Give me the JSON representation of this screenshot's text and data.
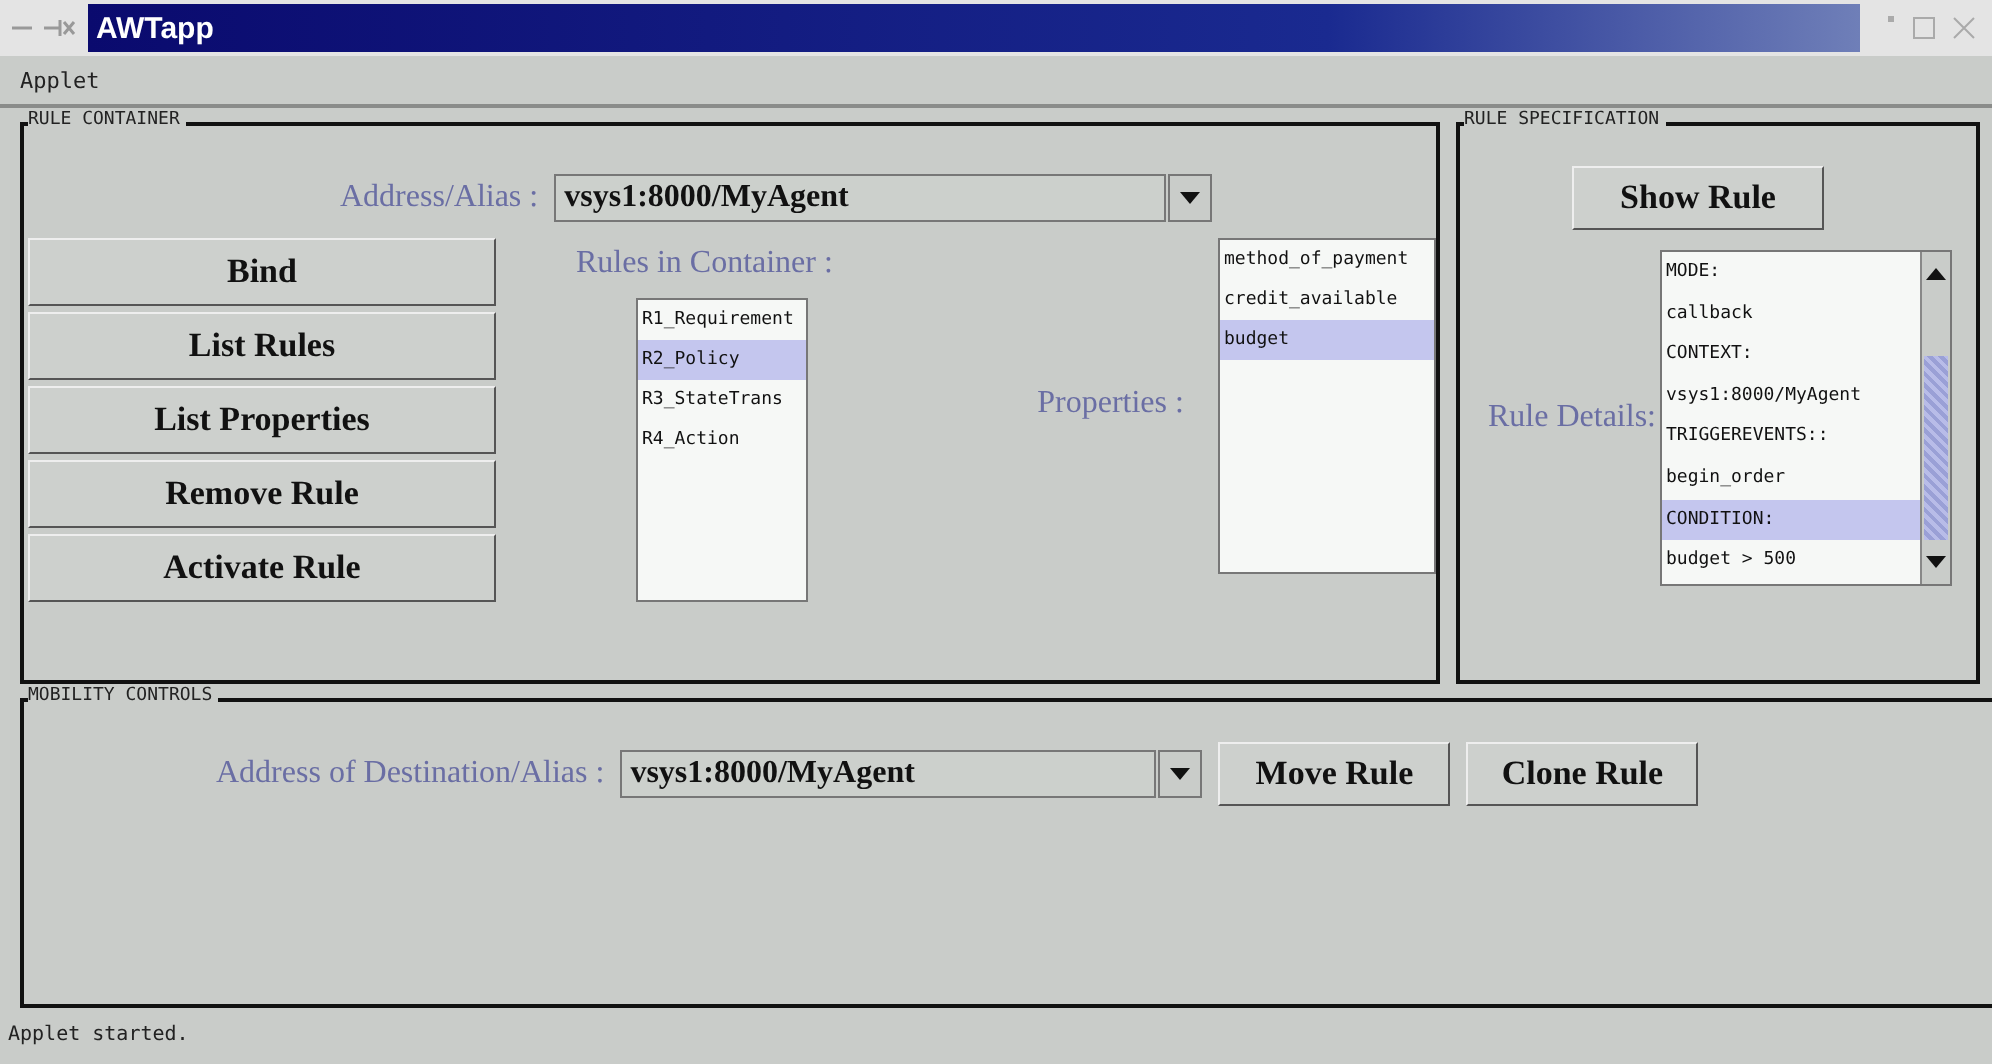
{
  "window": {
    "title": "AWTapp"
  },
  "menu": [
    "Applet"
  ],
  "rule_container": {
    "title": "RULE  CONTAINER",
    "address_label": "Address/Alias :",
    "address_value": "vsys1:8000/MyAgent",
    "buttons": [
      "Bind",
      "List Rules",
      "List Properties",
      "Remove Rule",
      "Activate Rule"
    ],
    "rules_label": "Rules in Container :",
    "rules": [
      {
        "label": "R1_Requirement",
        "selected": false
      },
      {
        "label": "R2_Policy",
        "selected": true
      },
      {
        "label": "R3_StateTrans",
        "selected": false
      },
      {
        "label": "R4_Action",
        "selected": false
      }
    ],
    "properties_label": "Properties :",
    "properties": [
      {
        "label": "method_of_payment",
        "selected": false
      },
      {
        "label": "credit_available",
        "selected": false
      },
      {
        "label": "budget",
        "selected": true
      }
    ]
  },
  "rule_specification": {
    "title": "RULE  SPECIFICATION",
    "button": "Show Rule",
    "details_label": "Rule Details:",
    "details": [
      {
        "label": "MODE:",
        "selected": false
      },
      {
        "label": "callback",
        "selected": false
      },
      {
        "label": "CONTEXT:",
        "selected": false
      },
      {
        "label": "vsys1:8000/MyAgent",
        "selected": false
      },
      {
        "label": "TRIGGEREVENTS::",
        "selected": false
      },
      {
        "label": "begin_order",
        "selected": false
      },
      {
        "label": "CONDITION:",
        "selected": true
      },
      {
        "label": "budget > 500",
        "selected": false
      }
    ]
  },
  "mobility_controls": {
    "title": "MOBILITY  CONTROLS",
    "destination_label": "Address of Destination/Alias :",
    "destination_value": "vsys1:8000/MyAgent",
    "buttons": [
      "Move Rule",
      "Clone Rule"
    ]
  },
  "status_bar": "Applet started."
}
